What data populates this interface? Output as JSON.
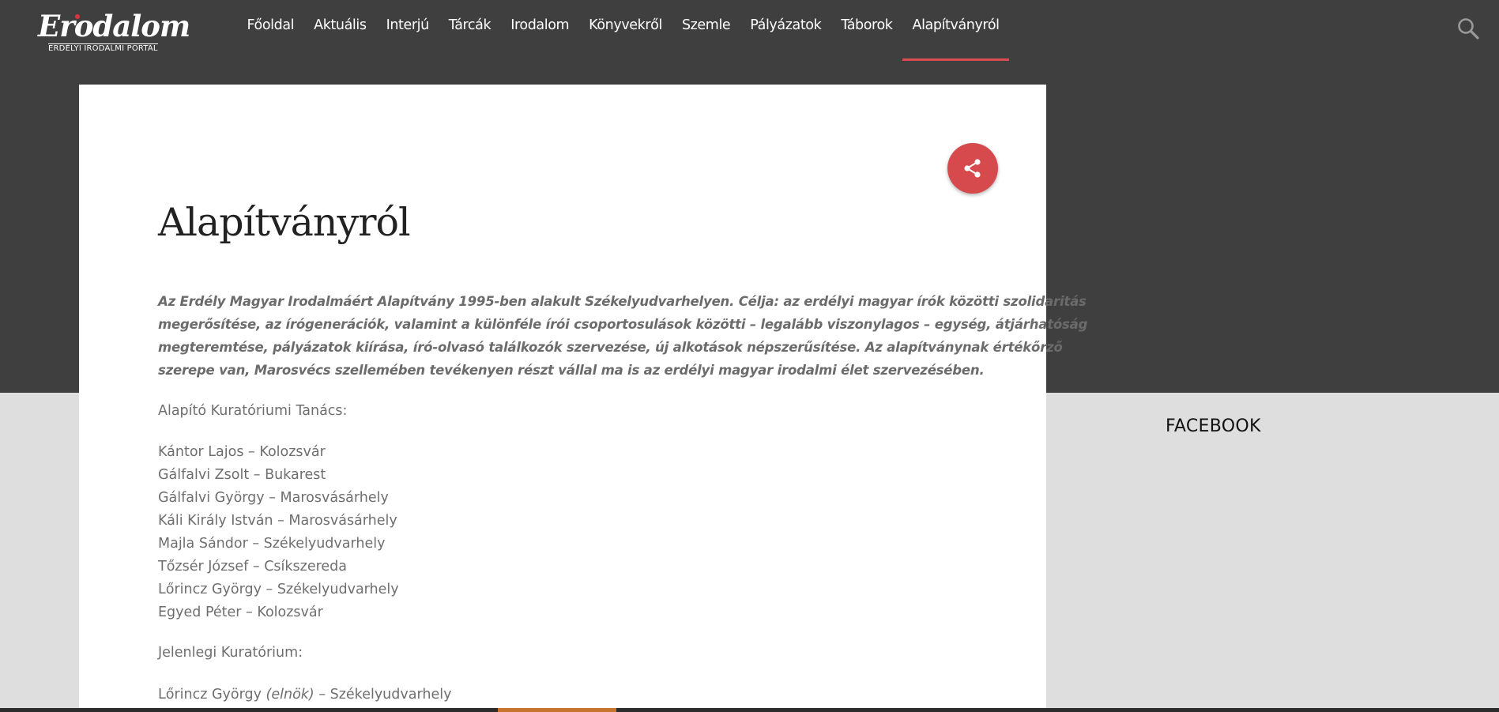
{
  "header": {
    "logo": {
      "wordmark": "Erodalom",
      "subtitle": "ERDÉLYI IRODALMI PORTÁL"
    },
    "nav": [
      {
        "label": "Főoldal",
        "active": false
      },
      {
        "label": "Aktuális",
        "active": false
      },
      {
        "label": "Interjú",
        "active": false
      },
      {
        "label": "Tárcák",
        "active": false
      },
      {
        "label": "Irodalom",
        "active": false
      },
      {
        "label": "Könyvekről",
        "active": false
      },
      {
        "label": "Szemle",
        "active": false
      },
      {
        "label": "Pályázatok",
        "active": false
      },
      {
        "label": "Táborok",
        "active": false
      },
      {
        "label": "Alapítványról",
        "active": true
      }
    ],
    "search_icon": "search-icon"
  },
  "article": {
    "title": "Alapítványról",
    "share_icon": "share-icon",
    "intro_lines": [
      "Az Erdély Magyar Irodalmáért Alapítvány 1995-ben alakult Székelyudvarhelyen. Célja: az erdélyi magyar írók közötti szolidaritás",
      "megerősítése, az írógenerációk, valamint a különféle írói csoportosulások közötti – legalább viszonylagos – egység, átjárhatóság",
      "megteremtése, pályázatok kiírása, író-olvasó találkozók szervezése, új alkotások népszerűsítése. Az alapítványnak értékőrző",
      "szerepe van, Marosvécs szellemében tevékenyen részt vállal ma is az erdélyi magyar irodalmi élet szervezésében."
    ],
    "founding_board_label": "Alapító Kuratóriumi Tanács:",
    "founding_members": [
      "Kántor Lajos – Kolozsvár",
      "Gálfalvi Zsolt – Bukarest",
      "Gálfalvi György – Marosvásárhely",
      "Káli Király István – Marosvásárhely",
      "Majla Sándor – Székelyudvarhely",
      "Tőzsér József – Csíkszereda",
      "Lőrincz György – Székelyudvarhely",
      "Egyed Péter – Kolozsvár"
    ],
    "current_board_label": "Jelenlegi Kuratórium:",
    "current_member": {
      "name": "Lőrincz György",
      "role": "(elnök)",
      "city": " – Székelyudvarhely"
    }
  },
  "sidebar": {
    "heading": "FACEBOOK"
  },
  "colors": {
    "header_bg": "#3f3f3f",
    "accent": "#d64a4e",
    "page_bg": "#dedede"
  }
}
